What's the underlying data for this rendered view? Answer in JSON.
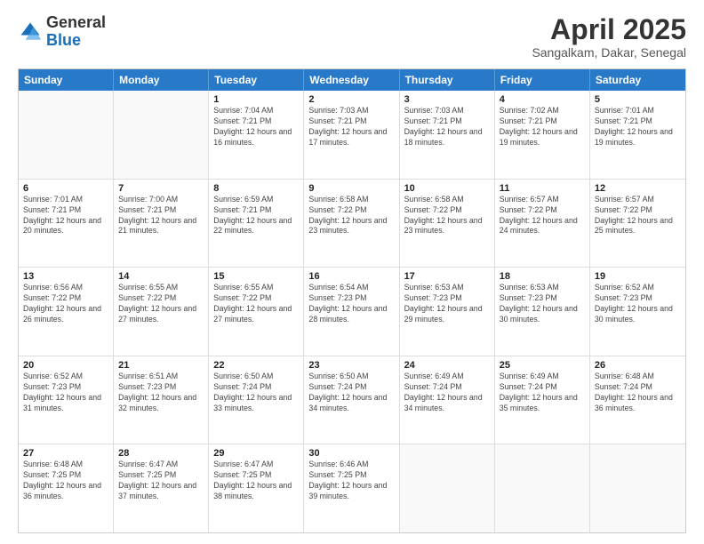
{
  "logo": {
    "general": "General",
    "blue": "Blue"
  },
  "header": {
    "month": "April 2025",
    "location": "Sangalkam, Dakar, Senegal"
  },
  "days": [
    "Sunday",
    "Monday",
    "Tuesday",
    "Wednesday",
    "Thursday",
    "Friday",
    "Saturday"
  ],
  "weeks": [
    [
      {
        "day": "",
        "sunrise": "",
        "sunset": "",
        "daylight": ""
      },
      {
        "day": "",
        "sunrise": "",
        "sunset": "",
        "daylight": ""
      },
      {
        "day": "1",
        "sunrise": "Sunrise: 7:04 AM",
        "sunset": "Sunset: 7:21 PM",
        "daylight": "Daylight: 12 hours and 16 minutes."
      },
      {
        "day": "2",
        "sunrise": "Sunrise: 7:03 AM",
        "sunset": "Sunset: 7:21 PM",
        "daylight": "Daylight: 12 hours and 17 minutes."
      },
      {
        "day": "3",
        "sunrise": "Sunrise: 7:03 AM",
        "sunset": "Sunset: 7:21 PM",
        "daylight": "Daylight: 12 hours and 18 minutes."
      },
      {
        "day": "4",
        "sunrise": "Sunrise: 7:02 AM",
        "sunset": "Sunset: 7:21 PM",
        "daylight": "Daylight: 12 hours and 19 minutes."
      },
      {
        "day": "5",
        "sunrise": "Sunrise: 7:01 AM",
        "sunset": "Sunset: 7:21 PM",
        "daylight": "Daylight: 12 hours and 19 minutes."
      }
    ],
    [
      {
        "day": "6",
        "sunrise": "Sunrise: 7:01 AM",
        "sunset": "Sunset: 7:21 PM",
        "daylight": "Daylight: 12 hours and 20 minutes."
      },
      {
        "day": "7",
        "sunrise": "Sunrise: 7:00 AM",
        "sunset": "Sunset: 7:21 PM",
        "daylight": "Daylight: 12 hours and 21 minutes."
      },
      {
        "day": "8",
        "sunrise": "Sunrise: 6:59 AM",
        "sunset": "Sunset: 7:21 PM",
        "daylight": "Daylight: 12 hours and 22 minutes."
      },
      {
        "day": "9",
        "sunrise": "Sunrise: 6:58 AM",
        "sunset": "Sunset: 7:22 PM",
        "daylight": "Daylight: 12 hours and 23 minutes."
      },
      {
        "day": "10",
        "sunrise": "Sunrise: 6:58 AM",
        "sunset": "Sunset: 7:22 PM",
        "daylight": "Daylight: 12 hours and 23 minutes."
      },
      {
        "day": "11",
        "sunrise": "Sunrise: 6:57 AM",
        "sunset": "Sunset: 7:22 PM",
        "daylight": "Daylight: 12 hours and 24 minutes."
      },
      {
        "day": "12",
        "sunrise": "Sunrise: 6:57 AM",
        "sunset": "Sunset: 7:22 PM",
        "daylight": "Daylight: 12 hours and 25 minutes."
      }
    ],
    [
      {
        "day": "13",
        "sunrise": "Sunrise: 6:56 AM",
        "sunset": "Sunset: 7:22 PM",
        "daylight": "Daylight: 12 hours and 26 minutes."
      },
      {
        "day": "14",
        "sunrise": "Sunrise: 6:55 AM",
        "sunset": "Sunset: 7:22 PM",
        "daylight": "Daylight: 12 hours and 27 minutes."
      },
      {
        "day": "15",
        "sunrise": "Sunrise: 6:55 AM",
        "sunset": "Sunset: 7:22 PM",
        "daylight": "Daylight: 12 hours and 27 minutes."
      },
      {
        "day": "16",
        "sunrise": "Sunrise: 6:54 AM",
        "sunset": "Sunset: 7:23 PM",
        "daylight": "Daylight: 12 hours and 28 minutes."
      },
      {
        "day": "17",
        "sunrise": "Sunrise: 6:53 AM",
        "sunset": "Sunset: 7:23 PM",
        "daylight": "Daylight: 12 hours and 29 minutes."
      },
      {
        "day": "18",
        "sunrise": "Sunrise: 6:53 AM",
        "sunset": "Sunset: 7:23 PM",
        "daylight": "Daylight: 12 hours and 30 minutes."
      },
      {
        "day": "19",
        "sunrise": "Sunrise: 6:52 AM",
        "sunset": "Sunset: 7:23 PM",
        "daylight": "Daylight: 12 hours and 30 minutes."
      }
    ],
    [
      {
        "day": "20",
        "sunrise": "Sunrise: 6:52 AM",
        "sunset": "Sunset: 7:23 PM",
        "daylight": "Daylight: 12 hours and 31 minutes."
      },
      {
        "day": "21",
        "sunrise": "Sunrise: 6:51 AM",
        "sunset": "Sunset: 7:23 PM",
        "daylight": "Daylight: 12 hours and 32 minutes."
      },
      {
        "day": "22",
        "sunrise": "Sunrise: 6:50 AM",
        "sunset": "Sunset: 7:24 PM",
        "daylight": "Daylight: 12 hours and 33 minutes."
      },
      {
        "day": "23",
        "sunrise": "Sunrise: 6:50 AM",
        "sunset": "Sunset: 7:24 PM",
        "daylight": "Daylight: 12 hours and 34 minutes."
      },
      {
        "day": "24",
        "sunrise": "Sunrise: 6:49 AM",
        "sunset": "Sunset: 7:24 PM",
        "daylight": "Daylight: 12 hours and 34 minutes."
      },
      {
        "day": "25",
        "sunrise": "Sunrise: 6:49 AM",
        "sunset": "Sunset: 7:24 PM",
        "daylight": "Daylight: 12 hours and 35 minutes."
      },
      {
        "day": "26",
        "sunrise": "Sunrise: 6:48 AM",
        "sunset": "Sunset: 7:24 PM",
        "daylight": "Daylight: 12 hours and 36 minutes."
      }
    ],
    [
      {
        "day": "27",
        "sunrise": "Sunrise: 6:48 AM",
        "sunset": "Sunset: 7:25 PM",
        "daylight": "Daylight: 12 hours and 36 minutes."
      },
      {
        "day": "28",
        "sunrise": "Sunrise: 6:47 AM",
        "sunset": "Sunset: 7:25 PM",
        "daylight": "Daylight: 12 hours and 37 minutes."
      },
      {
        "day": "29",
        "sunrise": "Sunrise: 6:47 AM",
        "sunset": "Sunset: 7:25 PM",
        "daylight": "Daylight: 12 hours and 38 minutes."
      },
      {
        "day": "30",
        "sunrise": "Sunrise: 6:46 AM",
        "sunset": "Sunset: 7:25 PM",
        "daylight": "Daylight: 12 hours and 39 minutes."
      },
      {
        "day": "",
        "sunrise": "",
        "sunset": "",
        "daylight": ""
      },
      {
        "day": "",
        "sunrise": "",
        "sunset": "",
        "daylight": ""
      },
      {
        "day": "",
        "sunrise": "",
        "sunset": "",
        "daylight": ""
      }
    ]
  ]
}
